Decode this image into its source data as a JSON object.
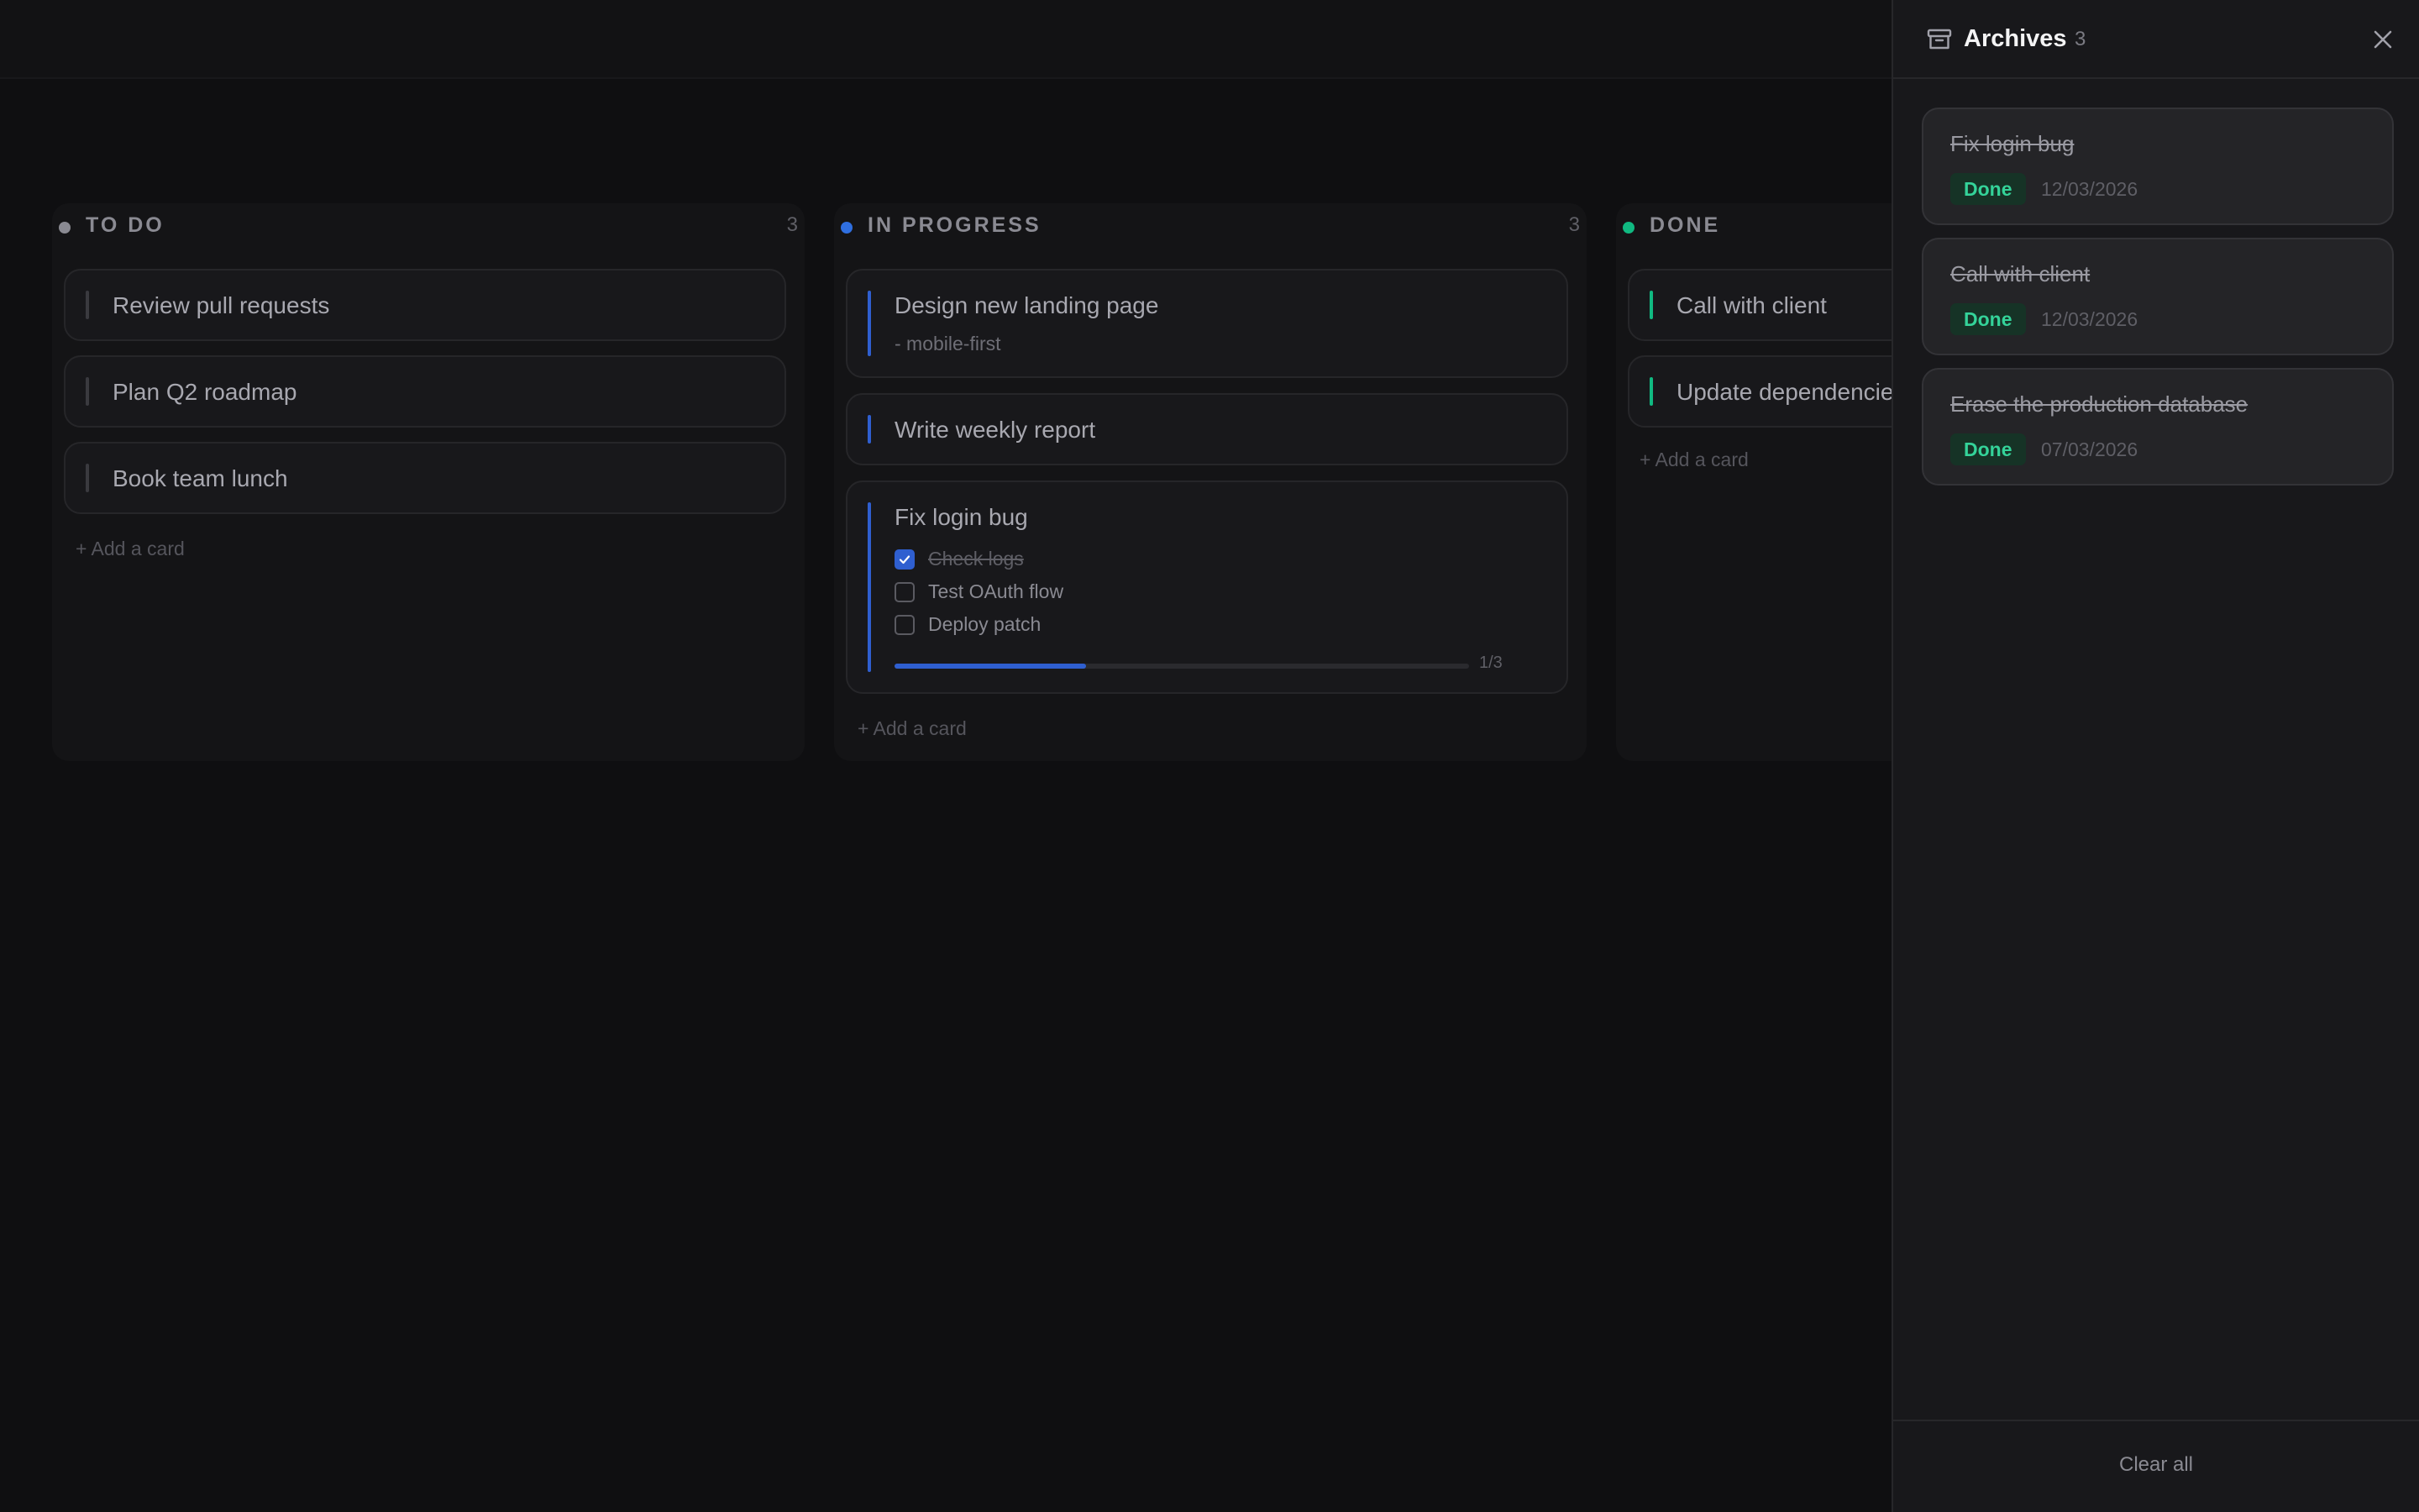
{
  "colors": {
    "todo": "#8a8a92",
    "in_progress": "#2f6fe0",
    "done": "#10b981",
    "accent": "#2f5fd0"
  },
  "columns": [
    {
      "title": "TO DO",
      "count": "3",
      "cards": [
        {
          "title": "Review pull requests"
        },
        {
          "title": "Plan Q2 roadmap"
        },
        {
          "title": "Book team lunch"
        }
      ],
      "add_label": "+ Add a card"
    },
    {
      "title": "IN PROGRESS",
      "count": "3",
      "cards": [
        {
          "title": "Design new landing page",
          "subtitle": "- mobile-first"
        },
        {
          "title": "Write weekly report"
        },
        {
          "title": "Fix login bug",
          "checklist": [
            {
              "label": "Check logs",
              "checked": true
            },
            {
              "label": "Test OAuth flow",
              "checked": false
            },
            {
              "label": "Deploy patch",
              "checked": false
            }
          ],
          "progress_fraction": 0.333,
          "progress_label": "1/3"
        }
      ],
      "add_label": "+ Add a card"
    },
    {
      "title": "DONE",
      "count": "",
      "cards": [
        {
          "title": "Call with client"
        },
        {
          "title": "Update dependencies"
        }
      ],
      "add_label": "+ Add a card"
    }
  ],
  "archives": {
    "title": "Archives",
    "count": "3",
    "items": [
      {
        "title": "Fix login bug",
        "status": "Done",
        "date": "12/03/2026"
      },
      {
        "title": "Call with client",
        "status": "Done",
        "date": "12/03/2026"
      },
      {
        "title": "Erase the production database",
        "status": "Done",
        "date": "07/03/2026"
      }
    ],
    "clear_label": "Clear all"
  }
}
